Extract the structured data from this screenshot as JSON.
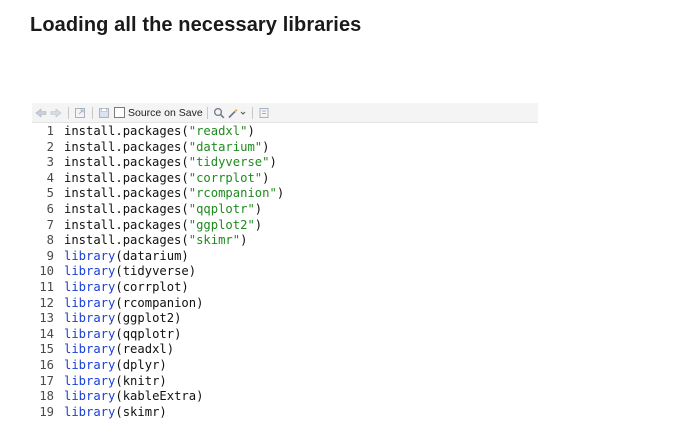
{
  "heading": "Loading all the necessary libraries",
  "toolbar": {
    "source_on_save_label": "Source on Save"
  },
  "code_lines": [
    {
      "number": "1",
      "fn": "install.packages",
      "arg": "\"readxl\"",
      "kind": "install"
    },
    {
      "number": "2",
      "fn": "install.packages",
      "arg": "\"datarium\"",
      "kind": "install"
    },
    {
      "number": "3",
      "fn": "install.packages",
      "arg": "\"tidyverse\"",
      "kind": "install"
    },
    {
      "number": "4",
      "fn": "install.packages",
      "arg": "\"corrplot\"",
      "kind": "install"
    },
    {
      "number": "5",
      "fn": "install.packages",
      "arg": "\"rcompanion\"",
      "kind": "install"
    },
    {
      "number": "6",
      "fn": "install.packages",
      "arg": "\"qqplotr\"",
      "kind": "install"
    },
    {
      "number": "7",
      "fn": "install.packages",
      "arg": "\"ggplot2\"",
      "kind": "install"
    },
    {
      "number": "8",
      "fn": "install.packages",
      "arg": "\"skimr\"",
      "kind": "install"
    },
    {
      "number": "9",
      "fn": "library",
      "arg": "datarium",
      "kind": "library"
    },
    {
      "number": "10",
      "fn": "library",
      "arg": "tidyverse",
      "kind": "library"
    },
    {
      "number": "11",
      "fn": "library",
      "arg": "corrplot",
      "kind": "library"
    },
    {
      "number": "12",
      "fn": "library",
      "arg": "rcompanion",
      "kind": "library"
    },
    {
      "number": "13",
      "fn": "library",
      "arg": "ggplot2",
      "kind": "library"
    },
    {
      "number": "14",
      "fn": "library",
      "arg": "qqplotr",
      "kind": "library"
    },
    {
      "number": "15",
      "fn": "library",
      "arg": "readxl",
      "kind": "library"
    },
    {
      "number": "16",
      "fn": "library",
      "arg": "dplyr",
      "kind": "library"
    },
    {
      "number": "17",
      "fn": "library",
      "arg": "knitr",
      "kind": "library"
    },
    {
      "number": "18",
      "fn": "library",
      "arg": "kableExtra",
      "kind": "library"
    },
    {
      "number": "19",
      "fn": "library",
      "arg": "skimr",
      "kind": "library"
    }
  ],
  "colors": {
    "library_fn": "#1a3fd6",
    "string": "#1f8a1f",
    "default_text": "#111111",
    "line_number": "#4a4a4a"
  }
}
